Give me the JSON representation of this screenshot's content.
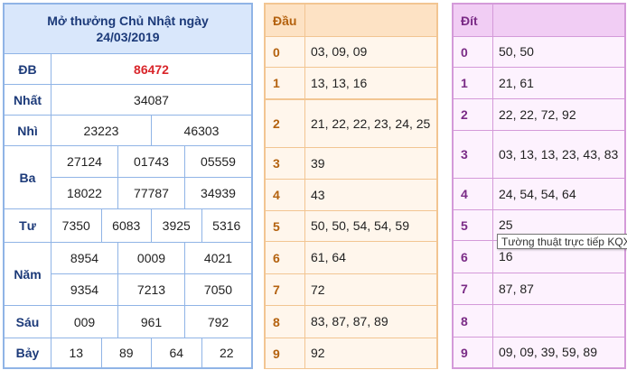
{
  "results": {
    "title_line1": "Mở thưởng Chủ Nhật ngày",
    "title_line2": "24/03/2019",
    "db_label": "ĐB",
    "db": "86472",
    "nhat_label": "Nhất",
    "nhat": "34087",
    "nhi_label": "Nhì",
    "nhi": [
      "23223",
      "46303"
    ],
    "ba_label": "Ba",
    "ba": [
      [
        "27124",
        "01743",
        "05559"
      ],
      [
        "18022",
        "77787",
        "34939"
      ]
    ],
    "tu_label": "Tư",
    "tu": [
      "7350",
      "6083",
      "3925",
      "5316"
    ],
    "nam_label": "Năm",
    "nam": [
      [
        "8954",
        "0009",
        "4021"
      ],
      [
        "9354",
        "7213",
        "7050"
      ]
    ],
    "sau_label": "Sáu",
    "sau": [
      "009",
      "961",
      "792"
    ],
    "bay_label": "Bảy",
    "bay": [
      "13",
      "89",
      "64",
      "22"
    ]
  },
  "dau": {
    "header": "Đầu",
    "rows": [
      {
        "k": "0",
        "v": "03, 09, 09"
      },
      {
        "k": "1",
        "v": "13, 13, 16"
      },
      {
        "k": "2",
        "v": "21, 22, 22, 23, 24, 25"
      },
      {
        "k": "3",
        "v": "39"
      },
      {
        "k": "4",
        "v": "43"
      },
      {
        "k": "5",
        "v": "50, 50, 54, 54, 59"
      },
      {
        "k": "6",
        "v": "61, 64"
      },
      {
        "k": "7",
        "v": "72"
      },
      {
        "k": "8",
        "v": "83, 87, 87, 89"
      },
      {
        "k": "9",
        "v": "92"
      }
    ]
  },
  "dit": {
    "header": "Đít",
    "rows": [
      {
        "k": "0",
        "v": "50, 50"
      },
      {
        "k": "1",
        "v": "21, 61"
      },
      {
        "k": "2",
        "v": "22, 22, 72, 92"
      },
      {
        "k": "3",
        "v": "03, 13, 13, 23, 43, 83"
      },
      {
        "k": "4",
        "v": "24, 54, 54, 64"
      },
      {
        "k": "5",
        "v": "25"
      },
      {
        "k": "6",
        "v": "16"
      },
      {
        "k": "7",
        "v": "87, 87"
      },
      {
        "k": "8",
        "v": ""
      },
      {
        "k": "9",
        "v": "09, 09, 39, 59, 89"
      }
    ]
  },
  "tooltip": "Tường thuật trực tiếp KQX"
}
